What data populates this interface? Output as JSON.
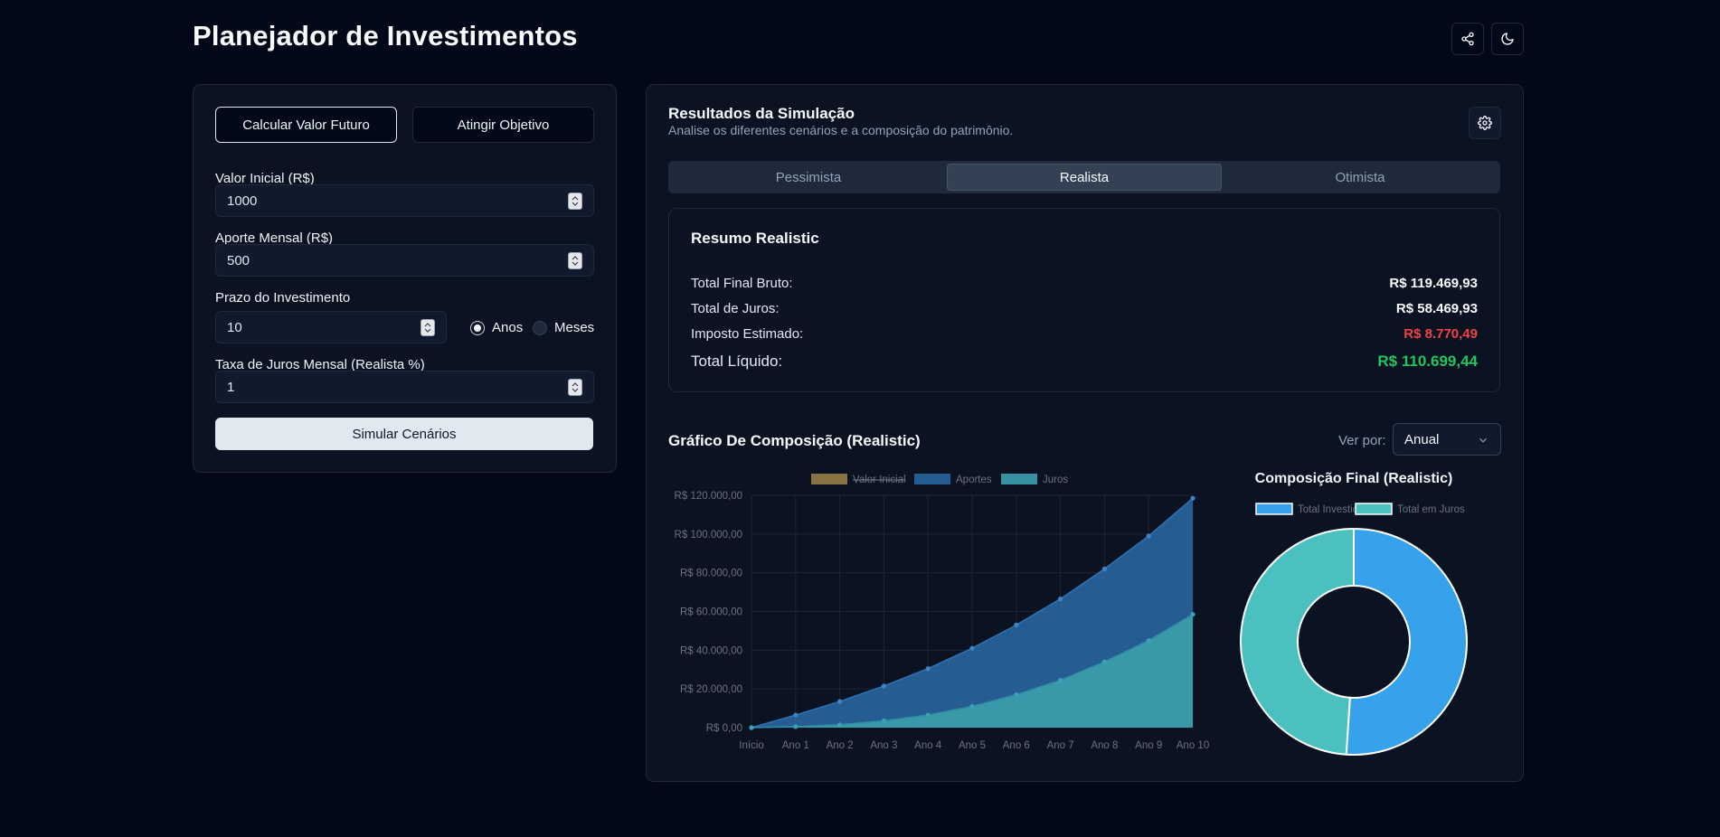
{
  "header": {
    "title": "Planejador de Investimentos",
    "icons": [
      "share-icon",
      "moon-icon"
    ]
  },
  "form": {
    "modes": [
      "Calcular Valor Futuro",
      "Atingir Objetivo"
    ],
    "initial_label": "Valor Inicial (R$)",
    "initial_value": "1000",
    "monthly_label": "Aporte Mensal (R$)",
    "monthly_value": "500",
    "term_label": "Prazo do Investimento",
    "term_value": "10",
    "unit_years": "Anos",
    "unit_months": "Meses",
    "unit_selected": "Anos",
    "rate_label": "Taxa de Juros Mensal (Realista %)",
    "rate_value": "1",
    "submit": "Simular Cenários"
  },
  "results": {
    "title": "Resultados da Simulação",
    "subtitle": "Analise os diferentes cenários e a composição do patrimônio.",
    "tabs": [
      "Pessimista",
      "Realista",
      "Otimista"
    ],
    "active_tab": "Realista",
    "summary": {
      "title": "Resumo Realistic",
      "rows": [
        {
          "label": "Total Final Bruto:",
          "value": "R$ 119.469,93"
        },
        {
          "label": "Total de Juros:",
          "value": "R$ 58.469,93"
        },
        {
          "label": "Imposto Estimado:",
          "value": "R$ 8.770,49"
        },
        {
          "label": "Total Líquido:",
          "value": "R$ 110.699,44"
        }
      ]
    },
    "chart_section": {
      "title": "Gráfico De Composição (Realistic)",
      "view_by_label": "Ver por:",
      "view_by_value": "Anual"
    }
  },
  "colors": {
    "background": "#020817",
    "card": "#0b1222",
    "red": "#ef4444",
    "green": "#22c55e",
    "aportes": "#2a6aa6",
    "juros": "#3fa8b8",
    "valor_inicial": "#a0844a",
    "pie_invested": "#36a2eb",
    "pie_interest": "#4bc0c0"
  },
  "chart_data": [
    {
      "type": "area",
      "title": "",
      "legend": [
        {
          "name": "Valor Inicial",
          "hidden": true
        },
        {
          "name": "Aportes"
        },
        {
          "name": "Juros"
        }
      ],
      "x": [
        "Início",
        "Ano 1",
        "Ano 2",
        "Ano 3",
        "Ano 4",
        "Ano 5",
        "Ano 6",
        "Ano 7",
        "Ano 8",
        "Ano 9",
        "Ano 10"
      ],
      "y_ticks": [
        "R$ 0,00",
        "R$ 20.000,00",
        "R$ 40.000,00",
        "R$ 60.000,00",
        "R$ 80.000,00",
        "R$ 100.000,00",
        "R$ 120.000,00"
      ],
      "ylim": [
        0,
        120000
      ],
      "stacked": true,
      "series": [
        {
          "name": "Juros",
          "values": [
            0,
            500,
            1500,
            3500,
            6500,
            11000,
            17000,
            24500,
            34000,
            45000,
            58500
          ]
        },
        {
          "name": "Aportes",
          "values": [
            0,
            6000,
            12000,
            18000,
            24000,
            30000,
            36000,
            42000,
            48000,
            54000,
            60000
          ]
        },
        {
          "name": "Valor Inicial",
          "values": [
            1000,
            1000,
            1000,
            1000,
            1000,
            1000,
            1000,
            1000,
            1000,
            1000,
            1000
          ]
        }
      ],
      "legend_position": "top",
      "grid": true
    },
    {
      "type": "pie",
      "title": "Composição Final (Realistic)",
      "labels": [
        "Total Investido",
        "Total em Juros"
      ],
      "values": [
        61000,
        58469.93
      ],
      "donut": true,
      "legend_position": "top"
    }
  ]
}
